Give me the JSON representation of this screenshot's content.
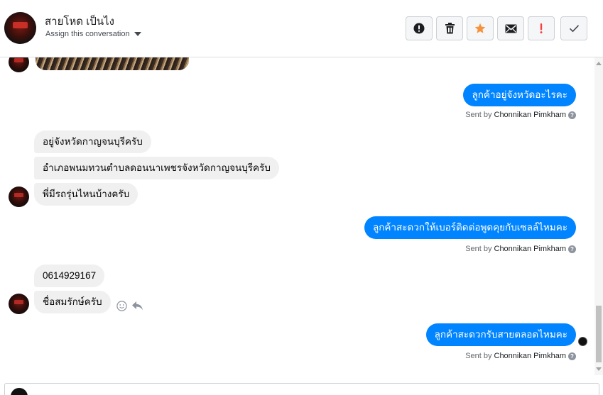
{
  "header": {
    "contact_name": "สายโหด เป็นไง",
    "assign_label": "Assign this conversation",
    "actions": [
      {
        "icon": "exclamation-circle-icon",
        "name": "mark-spam-button"
      },
      {
        "icon": "trash-icon",
        "name": "delete-button"
      },
      {
        "icon": "star-icon",
        "name": "star-button",
        "color": "#f7923b"
      },
      {
        "icon": "envelope-icon",
        "name": "mark-unread-button"
      },
      {
        "icon": "exclamation-icon",
        "name": "flag-button",
        "color": "#fa3e3e"
      },
      {
        "icon": "check-icon",
        "name": "mark-done-button"
      }
    ]
  },
  "messages": [
    {
      "dir": "out",
      "text": "ลูกค้าอยู่จังหวัดอะไรคะ",
      "sent_by_prefix": "Sent by",
      "sent_by_name": "Chonnikan Pimkham"
    },
    {
      "dir": "in",
      "text": "อยู่จังหวัดกาญจนบุรีครับ"
    },
    {
      "dir": "in",
      "text": "อำเภอพนมทวนตำบลดอนนาเพชรจังหวัดกาญจนบุรีครับ"
    },
    {
      "dir": "in",
      "text": "พี่มีรถรุ่นไหนบ้างครับ"
    },
    {
      "dir": "out",
      "text": "ลูกค้าสะดวกให้เบอร์ติดต่อพูดคุยกับเซลล์ไหมคะ",
      "sent_by_prefix": "Sent by",
      "sent_by_name": "Chonnikan Pimkham"
    },
    {
      "dir": "in",
      "text": "0614929167"
    },
    {
      "dir": "in",
      "text": "ชื่อสมรักษ์ครับ"
    },
    {
      "dir": "out",
      "text": "ลูกค้าสะดวกรับสายตลอดไหมคะ",
      "sent_by_prefix": "Sent by",
      "sent_by_name": "Chonnikan Pimkham"
    }
  ],
  "help_glyph": "?",
  "colors": {
    "outgoing_bubble": "#0084ff",
    "incoming_bubble": "#f0f0f0",
    "star": "#f7923b",
    "flag": "#fa3e3e"
  }
}
